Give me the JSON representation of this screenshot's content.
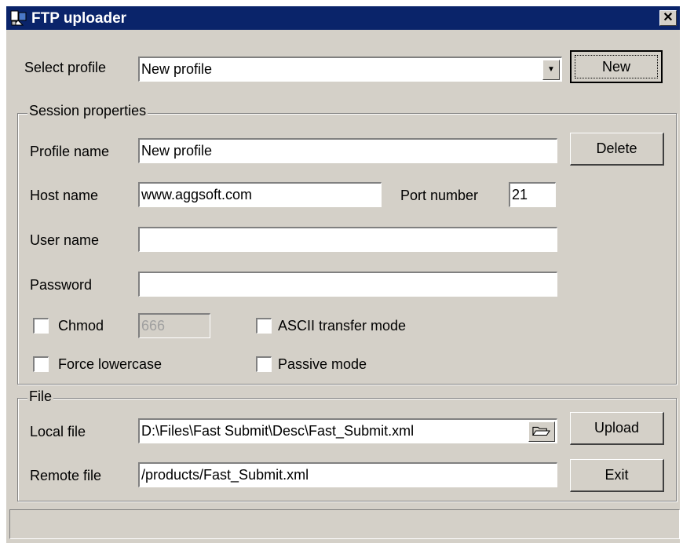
{
  "window": {
    "title": "FTP uploader"
  },
  "profile": {
    "label": "Select profile",
    "value": "New profile",
    "new_button": "New"
  },
  "session": {
    "group_title": "Session properties",
    "profile_name_label": "Profile name",
    "profile_name_value": "New profile",
    "delete_button": "Delete",
    "host_label": "Host name",
    "host_value": "www.aggsoft.com",
    "port_label": "Port number",
    "port_value": "21",
    "user_label": "User name",
    "user_value": "",
    "password_label": "Password",
    "password_value": "",
    "chmod_label": "Chmod",
    "chmod_value": "666",
    "chmod_checked": false,
    "ascii_label": "ASCII transfer mode",
    "ascii_checked": false,
    "lowercase_label": "Force lowercase",
    "lowercase_checked": false,
    "passive_label": "Passive mode",
    "passive_checked": false
  },
  "file": {
    "group_title": "File",
    "local_label": "Local file",
    "local_value": "D:\\Files\\Fast Submit\\Desc\\Fast_Submit.xml",
    "upload_button": "Upload",
    "remote_label": "Remote file",
    "remote_value": "/products/Fast_Submit.xml",
    "exit_button": "Exit"
  },
  "status": {
    "text": ""
  },
  "colors": {
    "titlebar": "#0a246a",
    "face": "#d4d0c8"
  }
}
